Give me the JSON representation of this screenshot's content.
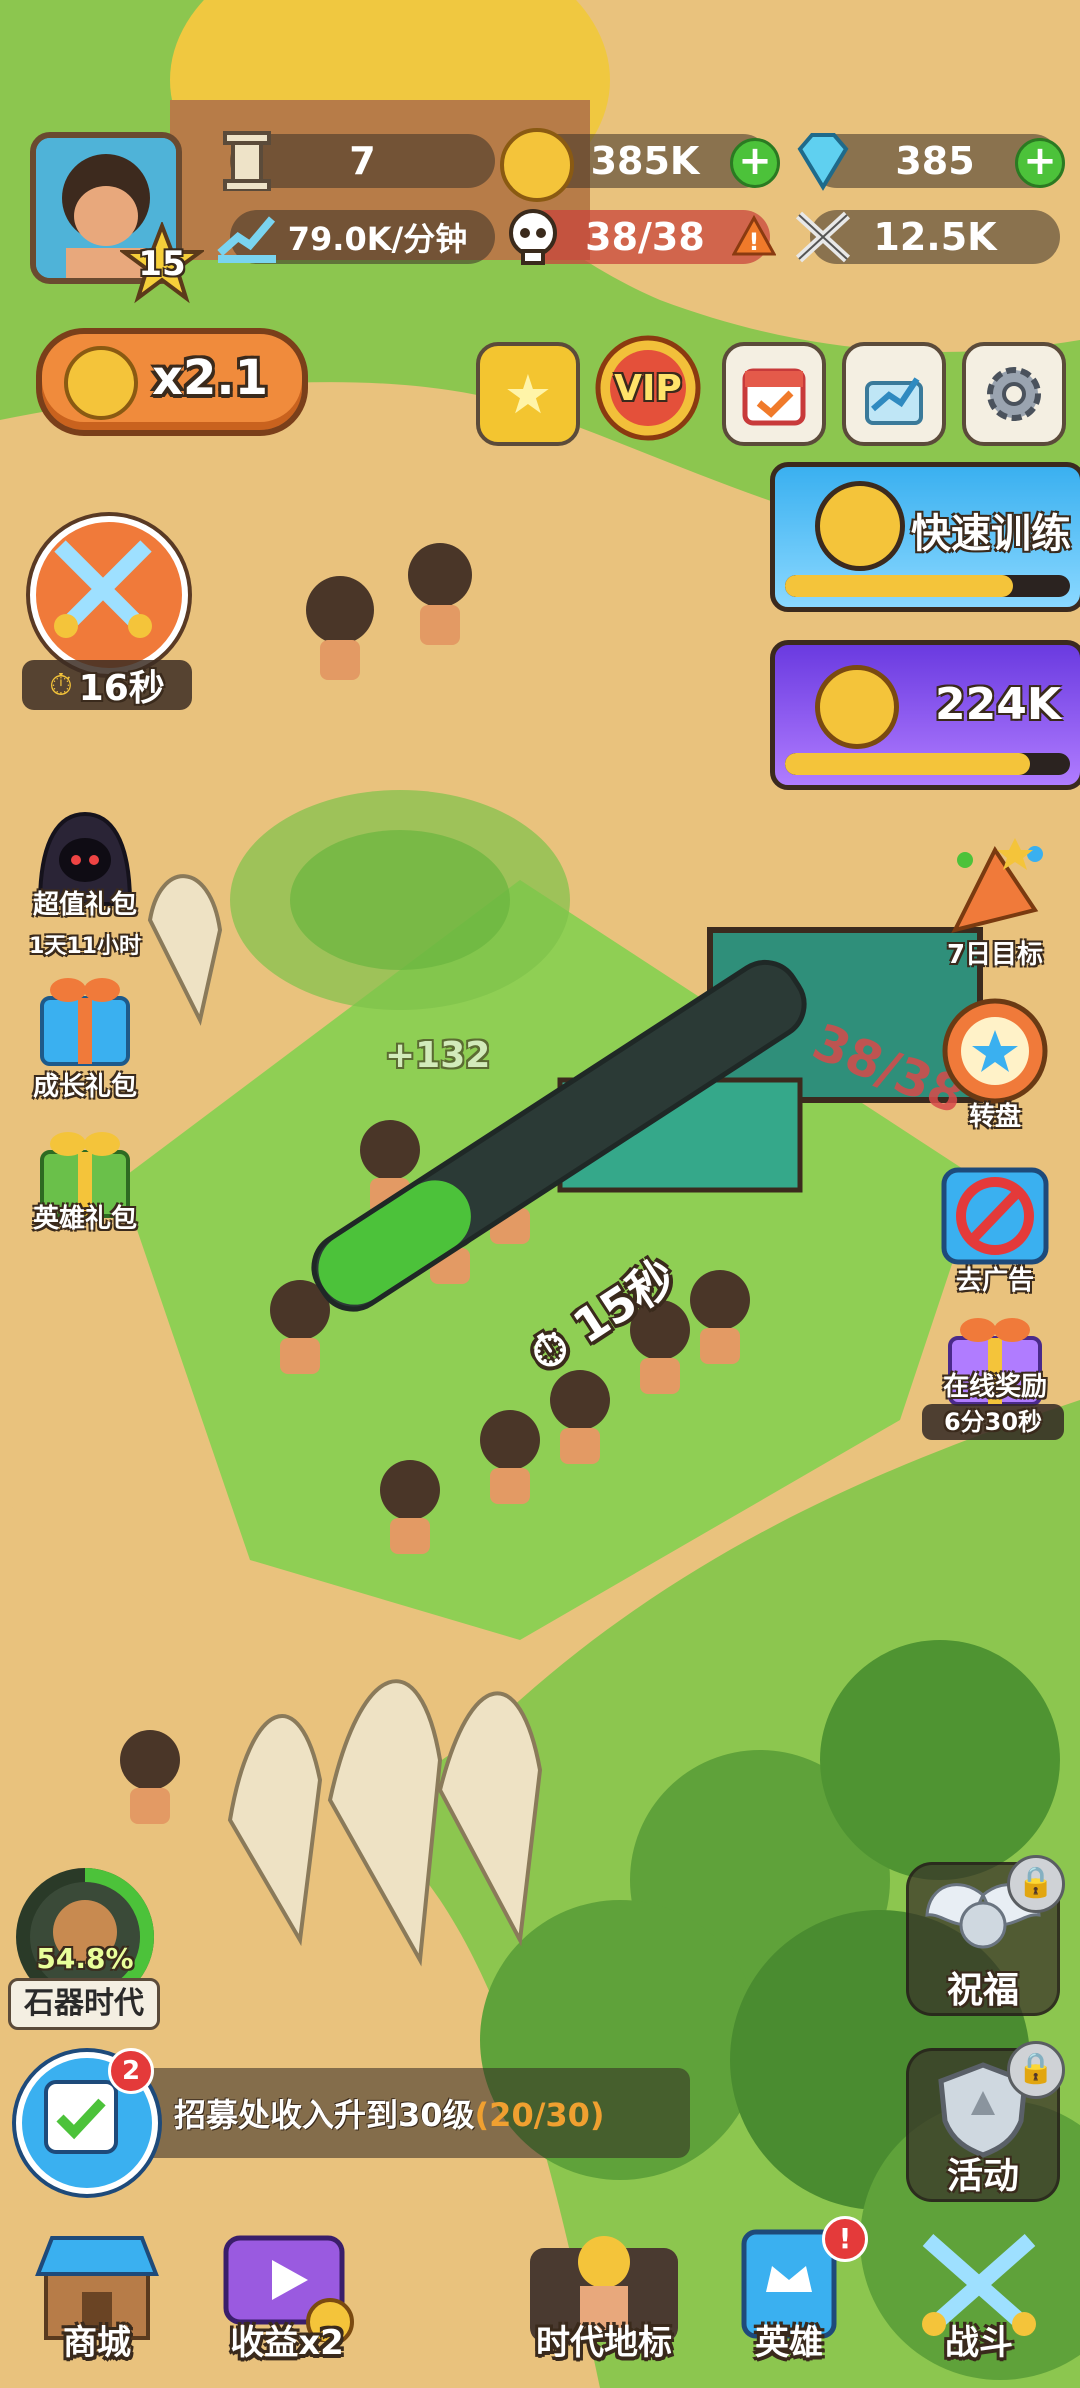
{
  "top_stats": {
    "population": "7",
    "gold": "385K",
    "gems": "385",
    "income_rate": "79.0K/分钟",
    "capacity": "38/38",
    "power": "12.5K"
  },
  "player": {
    "level": "15"
  },
  "boost": {
    "multiplier": "x2.1"
  },
  "top_icons": {
    "vip": "VIP"
  },
  "battle_timer": "16秒",
  "promos": {
    "quick_train_label": "快速训练",
    "quick_train_progress": 0.8,
    "coin_reward": "224K",
    "coin_progress": 0.86
  },
  "left_menu": {
    "super_pack": "超值礼包",
    "super_pack_timer": "1天11小时",
    "growth_pack": "成长礼包",
    "hero_pack": "英雄礼包"
  },
  "right_menu": {
    "seven_day": "7日目标",
    "wheel": "转盘",
    "no_ads": "去广告",
    "online_reward": "在线奖励",
    "online_timer": "6分30秒",
    "blessing": "祝福",
    "events": "活动"
  },
  "scene": {
    "building_counter": "38/38",
    "training_timer": "15秒",
    "floating_income": "+132",
    "training_progress": 0.3
  },
  "era": {
    "percent": "54.8%",
    "name": "石器时代",
    "progress": 0.548
  },
  "quest": {
    "badge": "2",
    "text": "招募处收入升到30级",
    "progress": "(20/30)"
  },
  "bottom_nav": {
    "shop": "商城",
    "income_x2": "收益x2",
    "landmark": "时代地标",
    "heroes": "英雄",
    "battle": "战斗"
  },
  "colors": {
    "grass": "#8cc64f",
    "dirt": "#e8c07a",
    "accent_orange": "#f08b3c",
    "gold": "#f4c43a",
    "green_progress": "#4cc23a",
    "quest_progress_text": "#f0a030"
  }
}
